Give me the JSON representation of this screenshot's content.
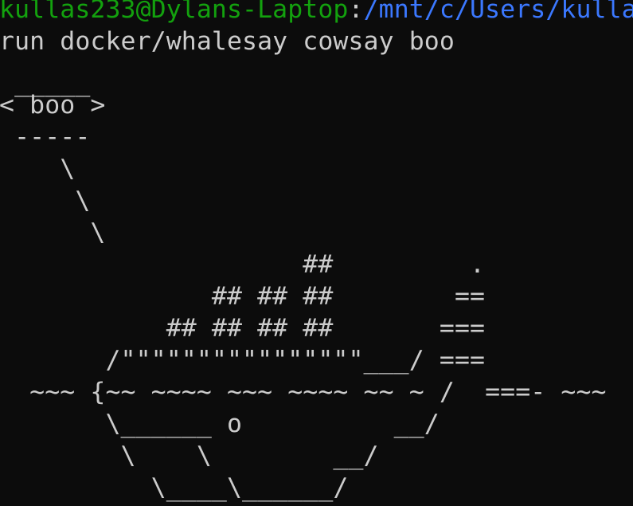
{
  "terminal": {
    "prompt": {
      "user_host": "kullas233@Dylans-Laptop",
      "separator": ":",
      "path": "/mnt/c/Users/kulla"
    },
    "command": "run docker/whalesay cowsay boo",
    "output_lines": [
      "",
      " _____",
      "< boo >",
      " -----",
      "    \\",
      "     \\",
      "      \\",
      "                    ##         .",
      "              ## ## ##        ==",
      "           ## ## ## ##       ===",
      "       /\"\"\"\"\"\"\"\"\"\"\"\"\"\"\"\"___/ ===",
      "  ~~~ {~~ ~~~~ ~~~ ~~~~ ~~ ~ /  ===- ~~~",
      "       \\______ o          __/",
      "        \\    \\        __/",
      "          \\____\\______/"
    ]
  },
  "colors": {
    "background": "#0c0c0c",
    "foreground": "#cccccc",
    "user_host": "#13a10e",
    "path": "#3b78ff"
  }
}
